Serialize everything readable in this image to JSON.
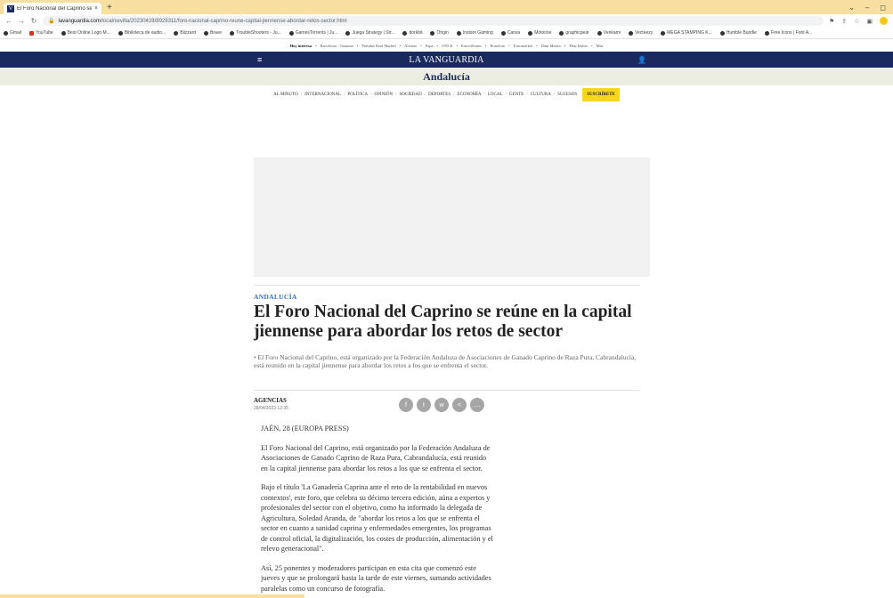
{
  "browser": {
    "tab_title": "El Foro Nacional del Caprino se r",
    "tab_close": "×",
    "new_tab": "+",
    "url_domain": "lavanguardia.com",
    "url_path": "/local/sevilla/20230428/8929311/foro-nacional-caprino-reune-capital-jiennense-abordar-retos-sector.html",
    "bookmarks": [
      "Gmail",
      "YouTube",
      "Best Online Logo M...",
      "Biblioteca de audio...",
      "Blizzard",
      "Brave",
      "TroubleShooters - Ju...",
      "GamesTorrents | Ju...",
      "Juega Strategy | Str...",
      "dorkbit",
      "Origin",
      "Instant Gaming",
      "Canva",
      "Motorise",
      "graphicpear",
      "Venkami",
      "Vecteezy",
      "MEGA STAMPING K...",
      "Humble Bundle",
      "Free Icons | Font A..."
    ]
  },
  "page": {
    "topics_label": "Hoy interesa",
    "topics": [
      "Barcelona · Osasuna",
      "Partidas Real Madrid",
      "Alcaraz",
      "Papa",
      "ONCE",
      "Eurovillones",
      "Bonoloto",
      "Euromarket",
      "Dani Martín",
      "Pilar Rubio",
      "Más"
    ],
    "logo": "LA VANGUARDIA",
    "section_title": "Andalucía",
    "sections": [
      "AL MINUTO",
      "INTERNACIONAL",
      "POLÍTICA",
      "OPINIÓN",
      "SOCIEDAD",
      "DEPORTES",
      "ECONOMÍA",
      "LOCAL",
      "GENTE",
      "CULTURA",
      "SUCESOS"
    ],
    "subscribe": "SUSCRÍBETE"
  },
  "article": {
    "kicker": "ANDALUCÍA",
    "headline": "El Foro Nacional del Caprino se reúne en la capital jiennense para abordar los retos de sector",
    "subhead": "• El Foro Nacional del Caprino, está organizado por la Federación Andaluza de Asociaciones de Ganado Caprino de Raza Pura, Cabrandalucía, está reunido en la capital jiennense para abordar los retos a los que se enfrenta el sector.",
    "author": "AGENCIAS",
    "date": "28/04/2023 12:35",
    "paragraphs": [
      "JAÉN, 28 (EUROPA PRESS)",
      "El Foro Nacional del Caprino, está organizado por la Federación Andaluza de Asociaciones de Ganado Caprino de Raza Pura, Cabrandalucía, está reunido en la capital jiennense para abordar los retos a los que se enfrenta el sector.",
      "Bajo el título 'La Ganadería Caprina ante el reto de la rentabilidad en nuevos contextos', este foro, que celebra su décimo tercera edición, aúna a expertos y profesionales del sector con el objetivo, como ha informado la delegada de Agricultura, Soledad Aranda, de \"abordar los retos a los que se enfrenta el sector en cuanto a sanidad caprina y enfermedades emergentes, los programas de control oficial, la digitalización, los costes de producción, alimentación y el relevo generacional\".",
      "Así, 25 ponentes y moderadores participan en esta cita que comenzó este jueves y que se prolongará hasta la tarde de este viernes, sumando actividades paralelas como un concurso de fotografía."
    ]
  }
}
